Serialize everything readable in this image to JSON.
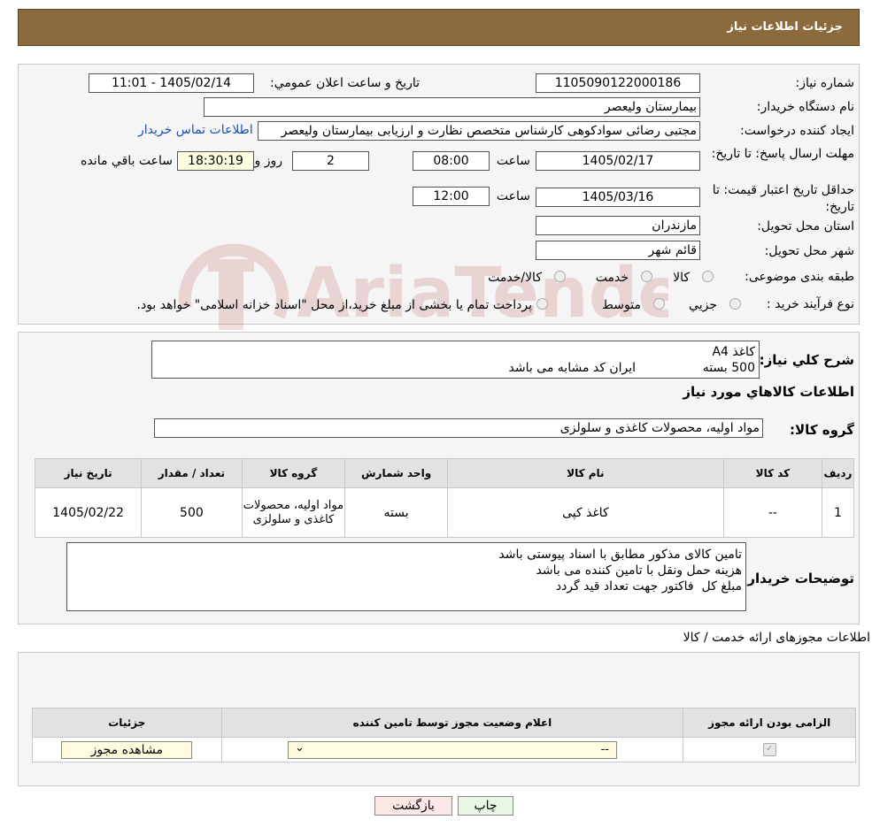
{
  "header": {
    "title": "جزئیات اطلاعات نیاز"
  },
  "watermark": {
    "text": "AriaTender.neT"
  },
  "info": {
    "need_number_label": "شماره نیاز:",
    "need_number": "1105090122000186",
    "announce_label": "تاریخ و ساعت اعلان عمومي:",
    "announce_value": "1405/02/14 - 11:01",
    "buyer_org_label": "نام دستگاه خریدار:",
    "buyer_org": "بیمارستان ولیعصر",
    "creator_label": "ایجاد کننده درخواست:",
    "creator": "مجتبی رضائی سوادکوهی کارشناس متخصص نظارت و ارزیابی بیمارستان ولیعصر",
    "contact_link": "اطلاعات تماس خریدار",
    "deadline_label": "مهلت ارسال پاسخ: تا تاریخ:",
    "deadline_date": "1405/02/17",
    "time_label": "ساعت",
    "deadline_time": "08:00",
    "days_value": "2",
    "days_label": "روز و",
    "remaining_time": "18:30:19",
    "remaining_label": "ساعت باقي مانده",
    "validity_label": "حداقل تاریخ اعتبار قیمت: تا تاریخ:",
    "validity_date": "1405/03/16",
    "validity_time": "12:00",
    "province_label": "استان محل تحویل:",
    "province": "مازندران",
    "city_label": "شهر محل تحویل:",
    "city": "قائم شهر",
    "category_label": "طبقه بندی موضوعی:",
    "category_options": [
      "کالا",
      "خدمت",
      "کالا/خدمت"
    ],
    "process_label": "نوع فرآیند خرید :",
    "process_options": [
      "جزیي",
      "متوسط"
    ],
    "process_note": "پرداخت تمام یا بخشی از مبلغ خرید،از محل \"اسناد خزانه اسلامی\" خواهد بود."
  },
  "description": {
    "label": "شرح کلي نیاز:",
    "line1": "کاغذ A4",
    "line2": "500 بسته                 ایران کد مشابه می باشد"
  },
  "goods": {
    "section_title": "اطلاعات کالاهاي مورد نیاز",
    "group_label": "گروه کالا:",
    "group_value": "مواد اولیه، محصولات کاغذی و سلولزی",
    "columns": [
      "ردیف",
      "کد کالا",
      "نام کالا",
      "واحد شمارش",
      "گروه کالا",
      "تعداد / مقدار",
      "تاریخ نیاز"
    ],
    "rows": [
      {
        "row": "1",
        "code": "--",
        "name": "کاغذ کپی",
        "unit": "بسته",
        "group": "مواد اولیه، محصولات کاغذی و سلولزی",
        "qty": "500",
        "date": "1405/02/22"
      }
    ]
  },
  "buyer_notes": {
    "label": "توضیحات خریدار:",
    "line1": "تامین کالای مذکور مطابق با اسناد پیوستی باشد",
    "line2": "هزینه حمل ونقل با تامین کننده می باشد",
    "line3": "مبلغ کل  فاکتور جهت تعداد قید گردد"
  },
  "permits": {
    "section_title": "اطلاعات مجوزهای ارائه خدمت / کالا",
    "columns": [
      "الزامی بودن ارائه مجوز",
      "اعلام وضعیت مجوز توسط تامین کننده",
      "جزئیات"
    ],
    "select_value": "--",
    "view_button": "مشاهده مجوز"
  },
  "actions": {
    "print": "چاپ",
    "back": "بازگشت"
  },
  "colors": {
    "header": "#8b6b3e",
    "accent_link": "#1a4fb5",
    "yellow_box": "#fffde0",
    "back_button": "#fde8e8",
    "print_button": "#eaf7e4"
  }
}
